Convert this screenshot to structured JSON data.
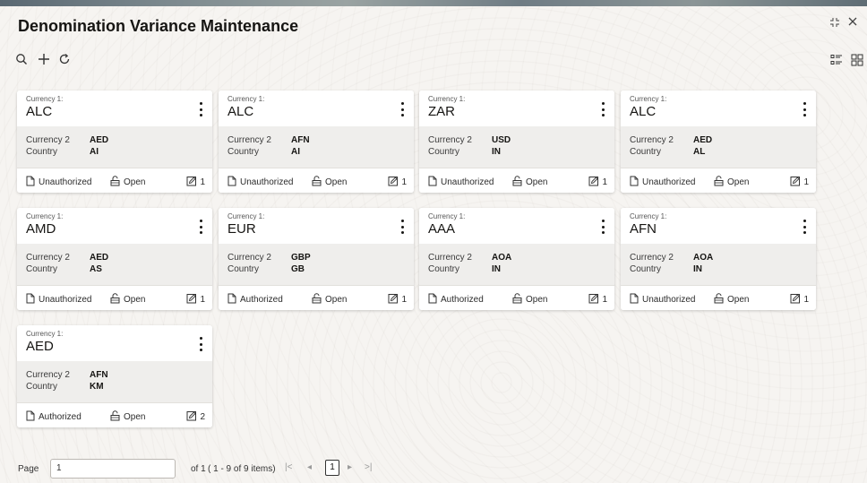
{
  "page": {
    "title": "Denomination Variance Maintenance"
  },
  "icons": {
    "search": "search-icon",
    "add": "plus-icon",
    "refresh": "refresh-icon",
    "list_view": "list-view-icon",
    "tile_view": "grid-view-icon",
    "maximize": "maximize-icon",
    "close": "close-icon",
    "more": "kebab-menu-icon",
    "status": "document-icon",
    "lock": "unlock-icon",
    "modification": "edit-icon"
  },
  "labels": {
    "currency1": "Currency 1:",
    "currency2": "Currency 2",
    "country": "Country"
  },
  "cards": [
    {
      "currency1": "ALC",
      "currency2": "AED",
      "country": "AI",
      "status": "Unauthorized",
      "lock": "Open",
      "mod_no": "1"
    },
    {
      "currency1": "ALC",
      "currency2": "AFN",
      "country": "AI",
      "status": "Unauthorized",
      "lock": "Open",
      "mod_no": "1"
    },
    {
      "currency1": "ZAR",
      "currency2": "USD",
      "country": "IN",
      "status": "Unauthorized",
      "lock": "Open",
      "mod_no": "1"
    },
    {
      "currency1": "ALC",
      "currency2": "AED",
      "country": "AL",
      "status": "Unauthorized",
      "lock": "Open",
      "mod_no": "1"
    },
    {
      "currency1": "AMD",
      "currency2": "AED",
      "country": "AS",
      "status": "Unauthorized",
      "lock": "Open",
      "mod_no": "1"
    },
    {
      "currency1": "EUR",
      "currency2": "GBP",
      "country": "GB",
      "status": "Authorized",
      "lock": "Open",
      "mod_no": "1"
    },
    {
      "currency1": "AAA",
      "currency2": "AOA",
      "country": "IN",
      "status": "Authorized",
      "lock": "Open",
      "mod_no": "1"
    },
    {
      "currency1": "AFN",
      "currency2": "AOA",
      "country": "IN",
      "status": "Unauthorized",
      "lock": "Open",
      "mod_no": "1"
    },
    {
      "currency1": "AED",
      "currency2": "AFN",
      "country": "KM",
      "status": "Authorized",
      "lock": "Open",
      "mod_no": "2"
    }
  ],
  "pagination": {
    "page_label": "Page",
    "page_value": "1",
    "of_text": "of 1",
    "items_text": "( 1 - 9 of 9 items)",
    "first": "|<",
    "prev": "◂",
    "current": "1",
    "next": "▸",
    "last": ">|"
  }
}
